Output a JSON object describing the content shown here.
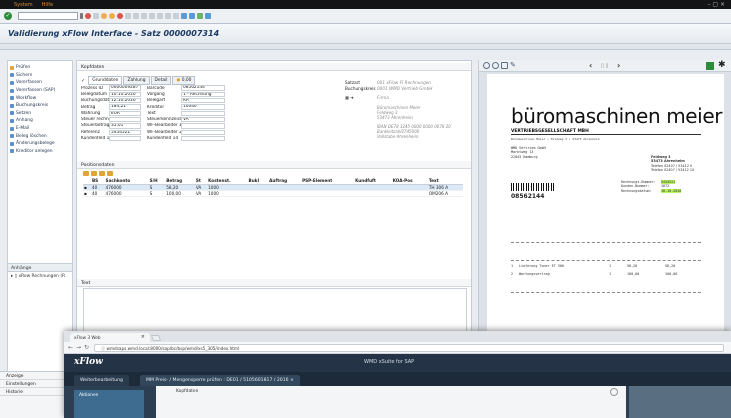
{
  "menubar": {
    "items": [
      "System",
      "Hilfe"
    ]
  },
  "title": "Validierung xFlow Interface - Satz 0000007314",
  "sidebar": {
    "items": [
      {
        "label": "Prüfen",
        "icon": "check-icon"
      },
      {
        "label": "Sichern",
        "icon": "save-icon"
      },
      {
        "label": "Vorerfassen",
        "icon": "edit-icon"
      },
      {
        "label": "Vorerfassen (SAP)",
        "icon": "edit-icon"
      },
      {
        "label": "Workflow",
        "icon": "workflow-icon"
      },
      {
        "label": "Buchungskreis",
        "icon": "company-icon"
      },
      {
        "label": "Setzen",
        "icon": "flag-icon"
      },
      {
        "label": "Anhang",
        "icon": "attachment-icon"
      },
      {
        "label": "E-Mail",
        "icon": "mail-icon"
      },
      {
        "label": "Beleg löschen",
        "icon": "delete-icon"
      },
      {
        "label": "Änderungsbelege",
        "icon": "history-icon"
      },
      {
        "label": "Kreditor anlegen",
        "icon": "vendor-icon"
      }
    ],
    "attachments_header": "Anhänge",
    "attachment_item": "xRow Rechnungen (R"
  },
  "kopfdaten": {
    "header": "Kopfdaten",
    "tabs": [
      "Grunddaten",
      "Zahlung",
      "Detail",
      "0,00"
    ],
    "left_fields": [
      {
        "label": "Prozess ID",
        "value": "0000009287"
      },
      {
        "label": "Belegdatum",
        "value": "10.10.2016"
      },
      {
        "label": "Buchungsdatum",
        "value": "12.10.2016"
      },
      {
        "label": "Betrag",
        "value": "184,21"
      },
      {
        "label": "Währung",
        "value": "EUR"
      },
      {
        "label": "Steuer rechnen",
        "value": ""
      },
      {
        "label": "Steuerbetrag",
        "value": "35,01"
      },
      {
        "label": "Referenz",
        "value": "5454521"
      },
      {
        "label": "Kundenfeld 13",
        "value": ""
      }
    ],
    "right_fields": [
      {
        "label": "Barcode",
        "value": "08562144"
      },
      {
        "label": "Vorgang",
        "value": "1 - Rechnung"
      },
      {
        "label": "Belegart",
        "value": "KR"
      },
      {
        "label": "Kreditor",
        "value": "10040"
      },
      {
        "label": "Text",
        "value": ""
      },
      {
        "label": "Steuerkennzeichen",
        "value": "VA"
      },
      {
        "label": "WF-Bearbeiter 1",
        "value": ""
      },
      {
        "label": "WF-Bearbeiter 2",
        "value": ""
      },
      {
        "label": "Kundenfeld 14",
        "value": ""
      }
    ],
    "info": [
      {
        "label": "Satzart",
        "value": "001   xFlow FI Rechnungen"
      },
      {
        "label": "Buchungskreis",
        "value": "0001   WMD Vertrieb GmbH"
      }
    ],
    "vendor_label": "Firma",
    "vendor_address": [
      "Büromaschinen Meier",
      "Feldweg 3",
      "53473 Ahrenheim"
    ],
    "vendor_bank": [
      "IBAN      DE78 3245 0000 0000 0078 20",
      "Bankleitzahl2745000",
      "Vollstabe Ahrenheim"
    ]
  },
  "positions": {
    "header": "Positionsdaten",
    "columns": [
      "BS",
      "Sachkonto",
      "S/H",
      "Betrag",
      "St",
      "Kostenst.",
      "BukI",
      "Auftrag",
      "PSP-Element",
      "Kundfuft",
      "KOA-Pos",
      "Text"
    ],
    "rows": [
      [
        "40",
        "476000",
        "S",
        "58,20",
        "VA",
        "1000",
        "",
        "",
        "",
        "",
        "",
        "TH 306 A"
      ],
      [
        "40",
        "476000",
        "S",
        "100,00",
        "VA",
        "1000",
        "",
        "",
        "",
        "",
        "",
        "OM206 A"
      ]
    ]
  },
  "text_section": {
    "header": "Text"
  },
  "document": {
    "company": "büromaschinen meier",
    "company_sub": "VERTRIEBSGESELLSCHAFT MBH",
    "address_line": "Büromaschinen Meier • Feldweg 3 • 53473 Ahrenheim",
    "recipient": [
      "WMD Vertrieb GmbH",
      "Marktweg 13",
      "",
      "22043 Hamburg"
    ],
    "sender_block": [
      "Feldweg 3",
      "53473 Ahrenheim",
      "Telefon 02407 / 53412 0",
      "Telefax 02407 / 53412 10"
    ],
    "invoice_labels": [
      "Rechnungs-Nummer:",
      "Kunden-Nummer:",
      "Rechnungsdatum:"
    ],
    "invoice_values": [
      "5454521",
      "1872",
      "10.10.2016"
    ],
    "barcode_number": "08562144",
    "lines": [
      {
        "pos": "1",
        "text": "Lieferung Toner ET 300",
        "qty": "1",
        "price": "58,20",
        "total": "58,20"
      },
      {
        "pos": "2",
        "text": "Wartungsvertrag",
        "qty": "1",
        "price": "100,00",
        "total": "100,00"
      }
    ]
  },
  "browser": {
    "tab_title": "xFlow 3 Web",
    "url": "wmdsaps.wmd.local:8000/sap/bc/bsp/wmd/xs5_305/index.html",
    "app_brand": "xFlow",
    "app_title": "WMD xSuite for SAP",
    "tabs": [
      "Weiterbearbeitung",
      "MM Preis- / Mengensperre prüfen : DE01 / 5105601817 / 2016"
    ],
    "aside": "Aktionen",
    "kopf": "Kopfdaten"
  },
  "bottom_left": [
    "Anzeige",
    "Einstellungen",
    "Historie"
  ]
}
